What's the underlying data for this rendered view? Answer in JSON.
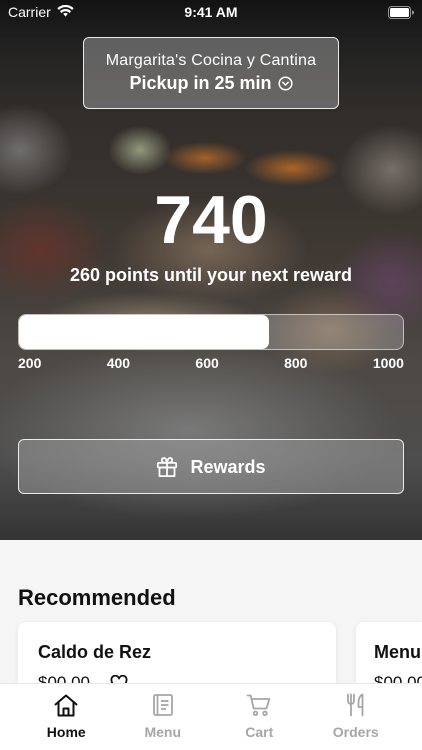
{
  "status_bar": {
    "carrier": "Carrier",
    "time": "9:41 AM",
    "wifi_icon": "wifi-icon",
    "battery_icon": "battery-icon"
  },
  "location_selector": {
    "restaurant_name": "Margarita's Cocina y Cantina",
    "pickup_text": "Pickup in 25 min",
    "icon": "chevron-down-circle-icon"
  },
  "rewards": {
    "points": 740,
    "message": "260 points until your next reward",
    "progress_ticks": [
      200,
      400,
      600,
      800,
      1000
    ],
    "button_label": "Rewards",
    "button_icon": "gift-icon"
  },
  "recommended": {
    "title": "Recommended",
    "items": [
      {
        "name": "Caldo de Rez",
        "price": "$00.00",
        "favorite_icon": "heart-icon"
      },
      {
        "name": "Menu",
        "price": "$00.00"
      }
    ]
  },
  "tab_bar": {
    "active_tab_index": 0,
    "tabs": [
      {
        "label": "Home",
        "icon": "home-icon"
      },
      {
        "label": "Menu",
        "icon": "menu-icon"
      },
      {
        "label": "Cart",
        "icon": "cart-icon"
      },
      {
        "label": "Orders",
        "icon": "fork-knife-icon"
      }
    ]
  },
  "colors": {
    "active_tab": "#111111",
    "inactive_tab": "#a6a6a6",
    "page_background": "#f5f5f5",
    "card_background": "#ffffff",
    "progress_fill": "#ffffff"
  }
}
